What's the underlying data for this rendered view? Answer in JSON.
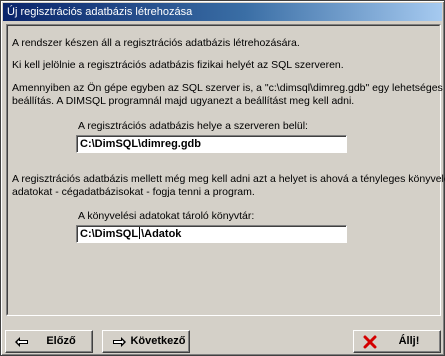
{
  "window": {
    "title": "Új regisztrációs adatbázis létrehozása"
  },
  "content": {
    "line1": "A rendszer készen áll a regisztrációs adatbázis létrehozására.",
    "line2": "Ki kell jelölnie a regisztrációs adatbázis fizikai helyét az SQL szerveren.",
    "line3a": "Amennyiben az Ön gépe egyben az SQL szerver is, a \"c:\\dimsql\\dimreg.gdb\" egy lehetséges",
    "line3b": "beállítás. A DIMSQL programnál majd ugyanezt a beállítást meg kell adni.",
    "reg_db_label": "A regisztrációs adatbázis helye a szerveren belül:",
    "reg_db_value": "C:\\DimSQL\\dimreg.gdb",
    "line4a": "A regisztrációs adatbázis mellett még meg kell adni azt a helyet is ahová a tényleges könyvelési",
    "line4b": "adatokat - cégadatbázisokat - fogja tenni a program.",
    "acc_dir_label": "A könyvelési adatokat tároló könyvtár:",
    "acc_dir_value_a": "C:\\DimSQL",
    "acc_dir_value_b": "\\Adatok"
  },
  "buttons": {
    "prev": {
      "label": "Előző",
      "icon": "arrow-left-icon"
    },
    "next": {
      "label": "Következő",
      "icon": "arrow-right-icon"
    },
    "stop": {
      "label": "Állj!",
      "icon": "red-x-icon"
    }
  },
  "colors": {
    "titlebar_start": "#0a246a",
    "titlebar_end": "#a6caf0",
    "stop_icon": "#d40000"
  }
}
